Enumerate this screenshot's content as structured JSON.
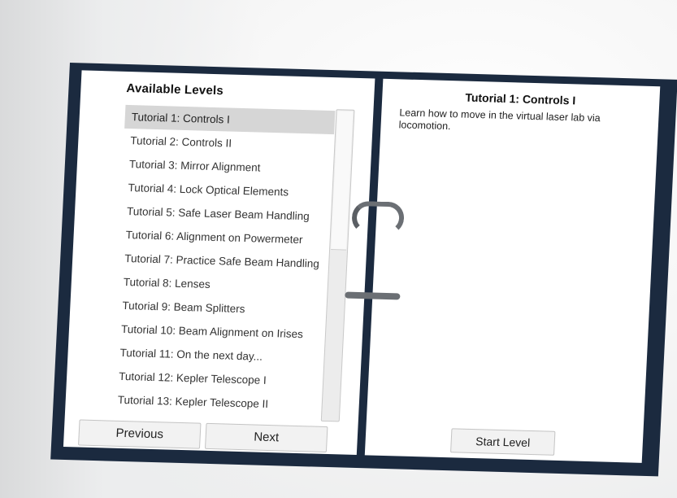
{
  "left_panel": {
    "title": "Available Levels",
    "levels": [
      "Tutorial 1: Controls I",
      "Tutorial 2: Controls II",
      "Tutorial 3: Mirror Alignment",
      "Tutorial 4: Lock Optical Elements",
      "Tutorial 5: Safe Laser Beam Handling",
      "Tutorial 6: Alignment on Powermeter",
      "Tutorial 7: Practice Safe Beam Handling",
      "Tutorial 8: Lenses",
      "Tutorial 9: Beam Splitters",
      "Tutorial 10: Beam Alignment on Irises",
      "Tutorial 11: On the next day...",
      "Tutorial 12: Kepler Telescope I",
      "Tutorial 13: Kepler Telescope II"
    ],
    "selected_index": 0,
    "previous_label": "Previous",
    "next_label": "Next"
  },
  "right_panel": {
    "title": "Tutorial 1: Controls I",
    "description": "Learn how to move in the virtual laser lab via locomotion.",
    "start_label": "Start Level"
  },
  "colors": {
    "binder_cover": "#1b2a3f",
    "page": "#ffffff",
    "selected_row": "#d6d6d6",
    "ring": "#6b6f74"
  }
}
